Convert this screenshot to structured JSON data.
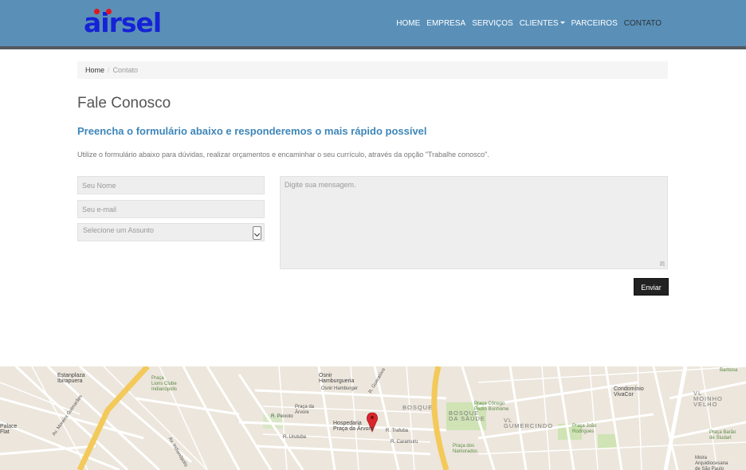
{
  "logo": {
    "text": "airsel"
  },
  "nav": {
    "items": [
      "HOME",
      "EMPRESA",
      "SERVIÇOS",
      "CLIENTES",
      "PARCEIROS",
      "CONTATO"
    ],
    "active": "CONTATO"
  },
  "breadcrumb": {
    "home": "Home",
    "current": "Contato"
  },
  "page": {
    "title": "Fale Conosco",
    "subtitle": "Preencha o formulário abaixo e responderemos o mais rápido possível",
    "intro": "Utilize o formulário abaixo para dúvidas, realizar orçamentos e encaminhar o seu currículo, através da opção \"Trabalhe conosco\"."
  },
  "form": {
    "name_placeholder": "Seu Nome",
    "email_placeholder": "Seu e-mail",
    "subject_selected": "Selecione um Assunto",
    "message_placeholder": "Digite sua mensagem.",
    "submit_label": "Enviar"
  },
  "map": {
    "labels": {
      "estanplaza": "Estanplaza\nIbirapuera",
      "lions": "Praça\nLions Clube\nIndianópolis",
      "palace": "Palace\nFlat",
      "osnir": "Osnir\nHamburgueria",
      "osnir_sub": "Osnir Hamburger",
      "praca_arvore": "Praça da\nÁrvore",
      "hospedaria": "Hospedaria\nPraça da Árvore",
      "bosque": "BOSQUE",
      "bosque_saude": "BOSQUE\nDA SAÚDE",
      "vl_gumercindo": "VL\nGUMERCINDO",
      "moinho_velho": "VL\nMOINHO\nVELHO",
      "condominio": "Condomínio\nVivaCor",
      "praca_conego": "Praça Cônego\nPedro Bonhome",
      "praca_joao": "Praça João\nRodrigues",
      "praca_namorados": "Praça dos\nNamorados",
      "praca_barao": "Praça Barão\nde Studart",
      "barbosa": "Barbosa",
      "moira": "Moira\nArquidiocesana\nde São Paulo",
      "av_moreira": "Av. Moreira Guimarães",
      "av_indianopolis": "Av. Indianópolis",
      "r_guaraiuva": "R. Guaraiúva",
      "r_trafuba": "R. Trafuba",
      "r_caramuru": "R. Caramuru",
      "r_uruguai": "R. Urutuba",
      "r_peixoto": "R. Peixoto"
    }
  }
}
